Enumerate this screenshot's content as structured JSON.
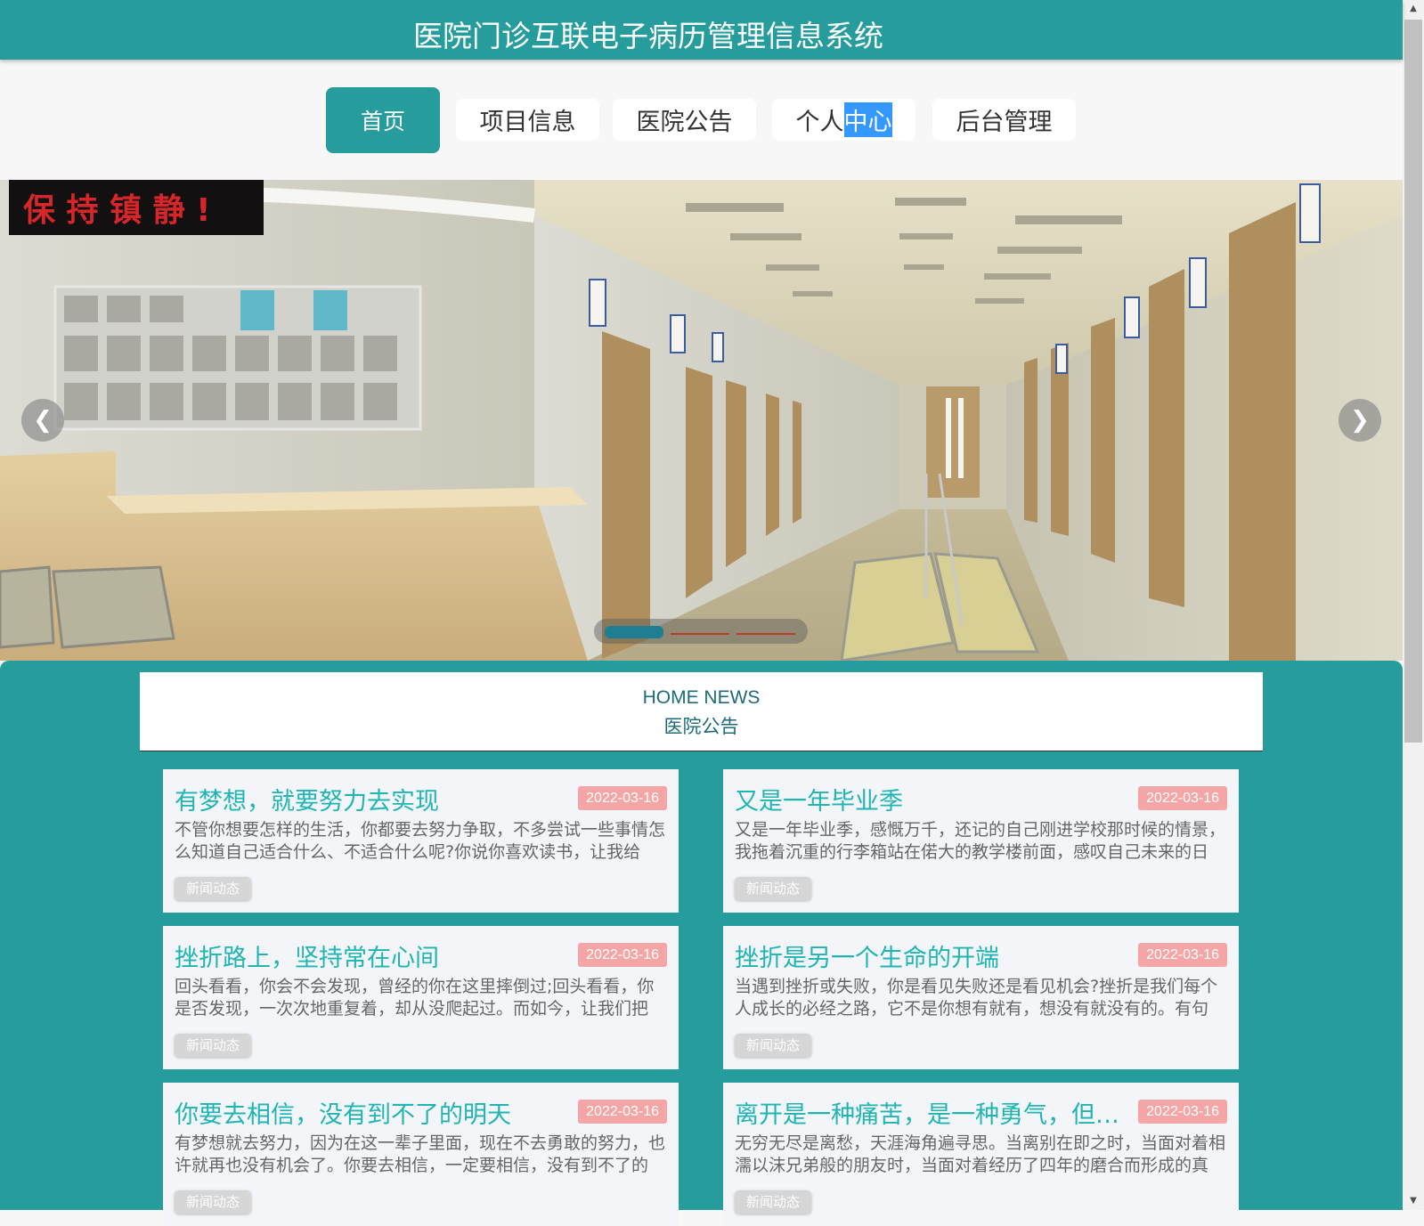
{
  "header": {
    "title": "医院门诊互联电子病历管理信息系统"
  },
  "nav": {
    "items": [
      {
        "label": "首页"
      },
      {
        "label": "项目信息"
      },
      {
        "label": "医院公告"
      },
      {
        "label_a": "个人",
        "label_b": "中心"
      },
      {
        "label": "后台管理"
      }
    ]
  },
  "banner": {
    "sign_text": "保 持 镇 静 !",
    "prev_icon": "chevron-left-icon",
    "next_icon": "chevron-right-icon",
    "slides_count": 3,
    "active_slide": 1
  },
  "news": {
    "heading_en": "HOME NEWS",
    "heading_cn": "医院公告",
    "cards": [
      {
        "title": "有梦想，就要努力去实现",
        "date": "2022-03-16",
        "desc": "不管你想要怎样的生活，你都要去努力争取，不多尝试一些事情怎么知道自己适合什么、不适合什么呢?你说你喜欢读书，让我给",
        "tag": "新闻动态"
      },
      {
        "title": "又是一年毕业季",
        "date": "2022-03-16",
        "desc": "又是一年毕业季，感慨万千，还记的自己刚进学校那时候的情景，我拖着沉重的行李箱站在偌大的教学楼前面，感叹自己未来的日",
        "tag": "新闻动态"
      },
      {
        "title": "挫折路上，坚持常在心间",
        "date": "2022-03-16",
        "desc": "回头看看，你会不会发现，曾经的你在这里摔倒过;回头看看，你是否发现，一次次地重复着，却从没爬起过。而如今，让我们把",
        "tag": "新闻动态"
      },
      {
        "title": "挫折是另一个生命的开端",
        "date": "2022-03-16",
        "desc": "当遇到挫折或失败，你是看见失败还是看见机会?挫折是我们每个人成长的必经之路，它不是你想有就有，想没有就没有的。有句",
        "tag": "新闻动态"
      },
      {
        "title": "你要去相信，没有到不了的明天",
        "date": "2022-03-16",
        "desc": "有梦想就去努力，因为在这一辈子里面，现在不去勇敢的努力，也许就再也没有机会了。你要去相信，一定要相信，没有到不了的",
        "tag": "新闻动态"
      },
      {
        "title": "离开是一种痛苦，是一种勇气，但同样也是一个考验",
        "date": "2022-03-16",
        "desc": "无穷无尽是离愁，天涯海角遍寻思。当离别在即之时，当面对着相濡以沫兄弟般的朋友时，当面对着经历了四年的磨合而形成的真",
        "tag": "新闻动态"
      }
    ]
  },
  "colors": {
    "primary": "#279c9c",
    "date_badge": "#f4a6a6",
    "card_title": "#1fb5b5",
    "selection": "#3399ff"
  }
}
